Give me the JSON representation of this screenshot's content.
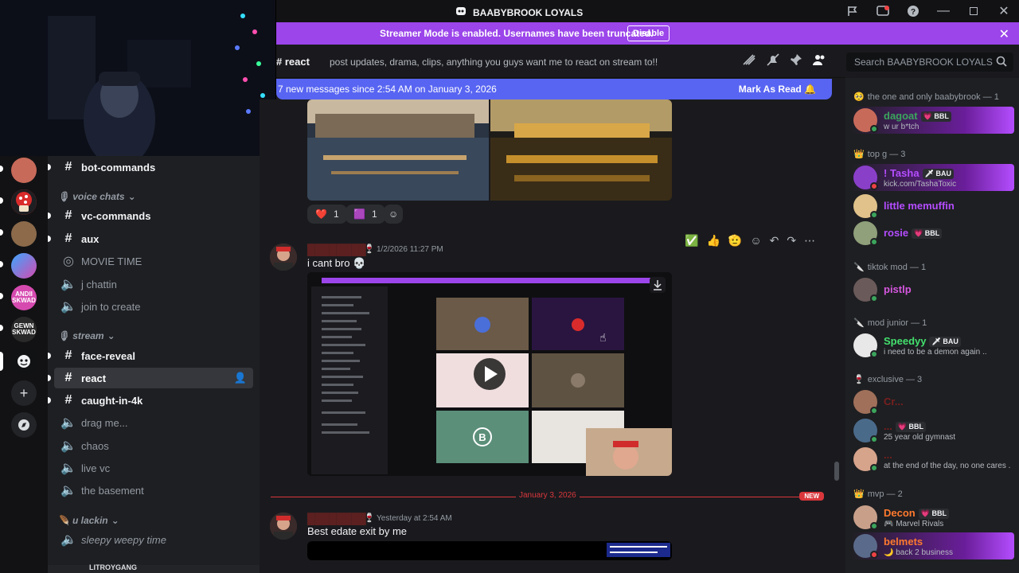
{
  "window": {
    "title": "BAABYBROOK LOYALS"
  },
  "banner": {
    "text": "Streamer Mode is enabled. Usernames have been truncated.",
    "button": "Disable"
  },
  "servers": [
    {
      "name": "server-1",
      "color": "#c86a5a"
    },
    {
      "name": "server-2",
      "color": "#d92b2b"
    },
    {
      "name": "server-3",
      "color": "#8c6a4a"
    },
    {
      "name": "server-4",
      "color": "#4a6fd9"
    },
    {
      "name": "andii-skwad",
      "label": "ANDII SKWAD",
      "color": "#d64ab0"
    },
    {
      "name": "gewn-skwad",
      "label": "GEWN SKWAD",
      "color": "#2a2a2a"
    },
    {
      "name": "baabybrook-loyals",
      "color": "#111214"
    }
  ],
  "sidebar": {
    "channels_top": [
      {
        "label": "bot-commands",
        "type": "text",
        "bright": true
      }
    ],
    "categories": {
      "voice": "voice chats",
      "stream": "stream",
      "lackin": "u lackin"
    },
    "voice_channels": [
      {
        "label": "vc-commands",
        "type": "text",
        "bright": true
      },
      {
        "label": "aux",
        "type": "text",
        "bright": true
      },
      {
        "label": "MOVIE TIME",
        "type": "stage",
        "bright": false
      },
      {
        "label": "j chattin",
        "type": "voice",
        "bright": false
      },
      {
        "label": "join to create",
        "type": "voice",
        "bright": false
      }
    ],
    "stream_channels": [
      {
        "label": "face-reveal",
        "type": "text",
        "bright": true
      },
      {
        "label": "react",
        "type": "text",
        "bright": true,
        "active": true
      },
      {
        "label": "caught-in-4k",
        "type": "text",
        "bright": true
      },
      {
        "label": "drag me...",
        "type": "voice",
        "bright": false
      },
      {
        "label": "chaos",
        "type": "voice",
        "bright": false
      },
      {
        "label": "live vc",
        "type": "voice",
        "bright": false
      },
      {
        "label": "the basement",
        "type": "voice",
        "bright": false
      }
    ],
    "lackin_channels": [
      {
        "label": "sleepy weepy time",
        "type": "voice",
        "bright": false
      }
    ],
    "footer_user": "LITROYGANG"
  },
  "header": {
    "channel": "react",
    "topic": "post updates, drama, clips, anything you guys want me to react on stream to!!",
    "search_placeholder": "Search BAABYBROOK LOYALS"
  },
  "new_messages": {
    "text": "7 new messages since 2:54 AM on January 3, 2026",
    "action": "Mark As Read"
  },
  "chat": {
    "reactions": [
      {
        "emoji": "❤️",
        "count": "1"
      },
      {
        "emoji": "🟪",
        "count": "1"
      }
    ],
    "message1": {
      "timestamp": "1/2/2026 11:27 PM",
      "text": "i cant bro 💀"
    },
    "divider": {
      "date": "January 3, 2026",
      "badge": "NEW"
    },
    "message2": {
      "timestamp": "Yesterday at 2:54 AM",
      "text": "Best edate exit by me"
    }
  },
  "members": {
    "groups": [
      {
        "label": "the one and only baabybrook — 1",
        "icon": "🥺"
      },
      {
        "label": "top g — 3",
        "icon": "👑"
      },
      {
        "label": "tiktok mod — 1",
        "icon": "🔪"
      },
      {
        "label": "mod junior — 1",
        "icon": "🔪"
      },
      {
        "label": "exclusive — 3",
        "icon": "🍷"
      },
      {
        "label": "mvp — 2",
        "icon": "👑"
      }
    ],
    "list": [
      {
        "name": "dagoat",
        "tag": "💗 BBL",
        "sub": "w ur b*tch",
        "color": "#3ba55c",
        "status": "#3ba55c",
        "grad": true
      },
      {
        "name": "! Tasha",
        "tag": "🗡 BAU",
        "sub": "kick.com/TashaToxic",
        "color": "#b44dff",
        "status": "#ed4245",
        "grad": true
      },
      {
        "name": "little memuffin",
        "tag": "",
        "sub": "",
        "color": "#b44dff",
        "status": "#3ba55c",
        "grad": false
      },
      {
        "name": "rosie",
        "tag": "💗 BBL",
        "sub": "",
        "color": "#b44dff",
        "status": "#3ba55c",
        "grad": false
      },
      {
        "name": "pistlp",
        "tag": "",
        "sub": "",
        "color": "#d657e0",
        "status": "#3ba55c",
        "grad": false
      },
      {
        "name": "Speedyy",
        "tag": "🗡 BAU",
        "sub": "i need to be a demon again ..",
        "color": "#43e06e",
        "status": "#3ba55c",
        "grad": false
      },
      {
        "name": "Cr...",
        "tag": "",
        "sub": "",
        "color": "#7a1f1f",
        "status": "#3ba55c",
        "grad": false
      },
      {
        "name": "...",
        "tag": "💗 BBL",
        "sub": "25 year old gymnast",
        "color": "#7a1f1f",
        "status": "#3ba55c",
        "grad": false
      },
      {
        "name": "...",
        "tag": "",
        "sub": "at the end of the day, no one cares ...",
        "color": "#7a1f1f",
        "status": "#3ba55c",
        "grad": false
      },
      {
        "name": "Decon",
        "tag": "💗 BBL",
        "sub": "🎮 Marvel Rivals",
        "color": "#ff7a2e",
        "status": "#3ba55c",
        "grad": false
      },
      {
        "name": "belmets",
        "tag": "",
        "sub": "🌙 back 2 business",
        "color": "#ff7a2e",
        "status": "#ed4245",
        "grad": true
      }
    ]
  }
}
